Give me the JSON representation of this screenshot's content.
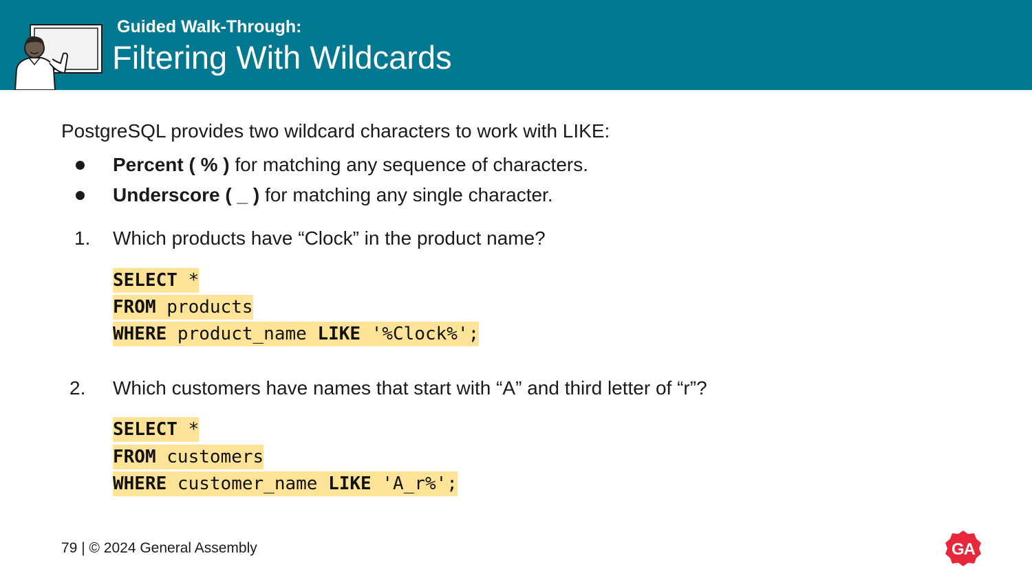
{
  "header": {
    "subtitle": "Guided Walk-Through:",
    "title": "Filtering With Wildcards",
    "background_color": "#037891",
    "illustration_icon": "person-at-whiteboard-icon"
  },
  "intro": "PostgreSQL provides two wildcard characters to work with LIKE:",
  "bullets": [
    {
      "bold": "Percent ( % )",
      "text": " for matching any sequence of characters."
    },
    {
      "bold": "Underscore ( _ )",
      "text": " for matching any single character."
    }
  ],
  "questions": [
    {
      "number": "1.",
      "text": "Which products have “Clock” in the product name?",
      "code": [
        {
          "kw1": "SELECT",
          "rest1": " *",
          "kw2": "",
          "rest2": ""
        },
        {
          "kw1": "FROM",
          "rest1": " products",
          "kw2": "",
          "rest2": ""
        },
        {
          "kw1": "WHERE",
          "rest1": " product_name ",
          "kw2": "LIKE",
          "rest2": " '%Clock%';"
        }
      ]
    },
    {
      "number": "2.",
      "text": "Which customers have names that start with “A” and third letter of “r”?",
      "code": [
        {
          "kw1": "SELECT",
          "rest1": " *",
          "kw2": "",
          "rest2": ""
        },
        {
          "kw1": "FROM",
          "rest1": " customers",
          "kw2": "",
          "rest2": ""
        },
        {
          "kw1": "WHERE",
          "rest1": " customer_name ",
          "kw2": "LIKE",
          "rest2": " 'A_r%';"
        }
      ]
    }
  ],
  "code_highlight_color": "#fde397",
  "footer": {
    "page_number": "79",
    "separator": " | ",
    "copyright": "© 2024 General Assembly"
  },
  "logo": {
    "text": "GA",
    "color": "#e6283a",
    "icon": "general-assembly-logo-icon"
  }
}
